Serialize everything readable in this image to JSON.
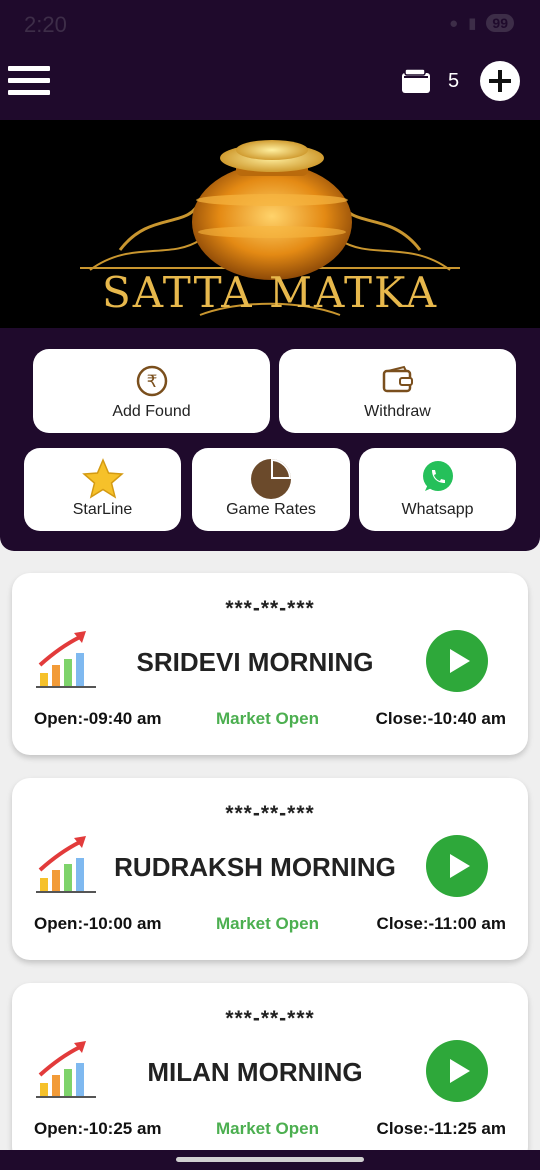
{
  "status_bar": {
    "time": "2:20",
    "battery": "99"
  },
  "header": {
    "wallet_count": "5"
  },
  "banner": {
    "title": "SATTA MATKA"
  },
  "actions": {
    "add_found": "Add Found",
    "withdraw": "Withdraw",
    "starline": "StarLine",
    "game_rates": "Game Rates",
    "whatsapp": "Whatsapp"
  },
  "markets": [
    {
      "result": "***-**-***",
      "name": "SRIDEVI MORNING",
      "open": "Open:-09:40 am",
      "status": "Market Open",
      "close": "Close:-10:40 am"
    },
    {
      "result": "***-**-***",
      "name": "RUDRAKSH MORNING",
      "open": "Open:-10:00 am",
      "status": "Market Open",
      "close": "Close:-11:00 am"
    },
    {
      "result": "***-**-***",
      "name": "MILAN MORNING",
      "open": "Open:-10:25 am",
      "status": "Market Open",
      "close": "Close:-11:25 am"
    }
  ],
  "colors": {
    "header_bg": "#1f0a2c",
    "play_green": "#2ea83a",
    "status_green": "#4caf50",
    "gold": "#e7b84c"
  }
}
